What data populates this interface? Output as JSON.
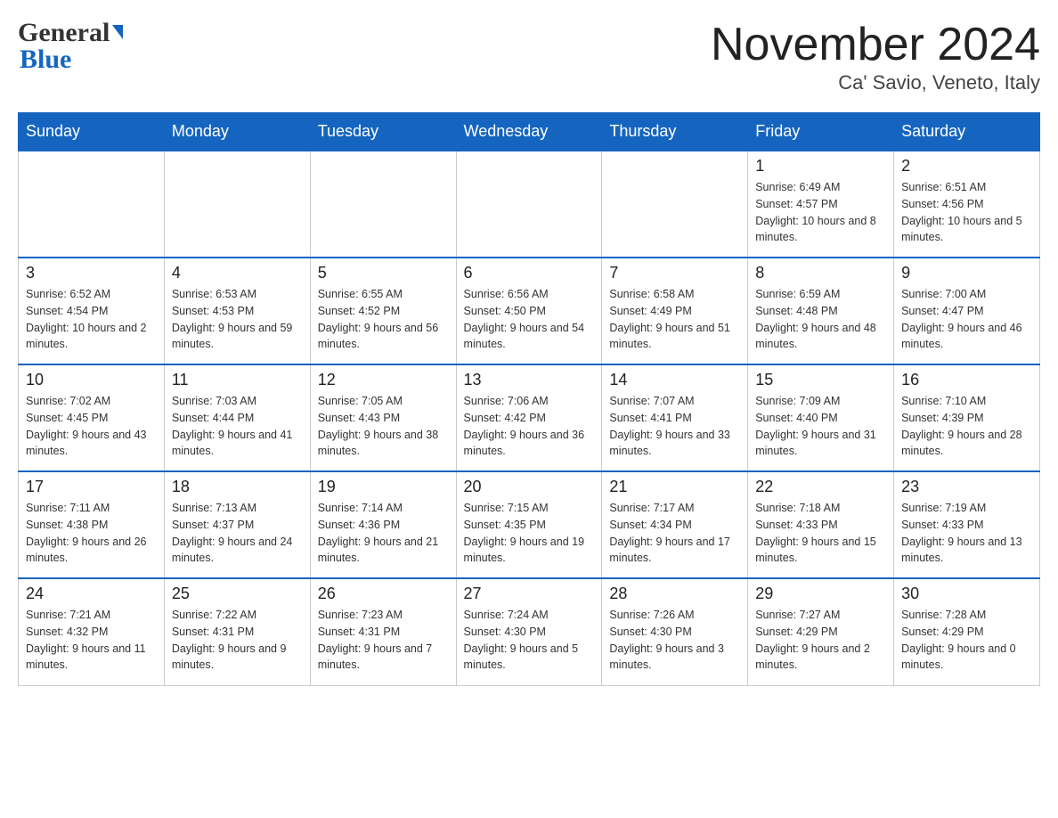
{
  "header": {
    "logo_general": "General",
    "logo_blue": "Blue",
    "month_title": "November 2024",
    "location": "Ca' Savio, Veneto, Italy"
  },
  "weekdays": [
    "Sunday",
    "Monday",
    "Tuesday",
    "Wednesday",
    "Thursday",
    "Friday",
    "Saturday"
  ],
  "weeks": [
    [
      {
        "day": "",
        "sunrise": "",
        "sunset": "",
        "daylight": ""
      },
      {
        "day": "",
        "sunrise": "",
        "sunset": "",
        "daylight": ""
      },
      {
        "day": "",
        "sunrise": "",
        "sunset": "",
        "daylight": ""
      },
      {
        "day": "",
        "sunrise": "",
        "sunset": "",
        "daylight": ""
      },
      {
        "day": "",
        "sunrise": "",
        "sunset": "",
        "daylight": ""
      },
      {
        "day": "1",
        "sunrise": "Sunrise: 6:49 AM",
        "sunset": "Sunset: 4:57 PM",
        "daylight": "Daylight: 10 hours and 8 minutes."
      },
      {
        "day": "2",
        "sunrise": "Sunrise: 6:51 AM",
        "sunset": "Sunset: 4:56 PM",
        "daylight": "Daylight: 10 hours and 5 minutes."
      }
    ],
    [
      {
        "day": "3",
        "sunrise": "Sunrise: 6:52 AM",
        "sunset": "Sunset: 4:54 PM",
        "daylight": "Daylight: 10 hours and 2 minutes."
      },
      {
        "day": "4",
        "sunrise": "Sunrise: 6:53 AM",
        "sunset": "Sunset: 4:53 PM",
        "daylight": "Daylight: 9 hours and 59 minutes."
      },
      {
        "day": "5",
        "sunrise": "Sunrise: 6:55 AM",
        "sunset": "Sunset: 4:52 PM",
        "daylight": "Daylight: 9 hours and 56 minutes."
      },
      {
        "day": "6",
        "sunrise": "Sunrise: 6:56 AM",
        "sunset": "Sunset: 4:50 PM",
        "daylight": "Daylight: 9 hours and 54 minutes."
      },
      {
        "day": "7",
        "sunrise": "Sunrise: 6:58 AM",
        "sunset": "Sunset: 4:49 PM",
        "daylight": "Daylight: 9 hours and 51 minutes."
      },
      {
        "day": "8",
        "sunrise": "Sunrise: 6:59 AM",
        "sunset": "Sunset: 4:48 PM",
        "daylight": "Daylight: 9 hours and 48 minutes."
      },
      {
        "day": "9",
        "sunrise": "Sunrise: 7:00 AM",
        "sunset": "Sunset: 4:47 PM",
        "daylight": "Daylight: 9 hours and 46 minutes."
      }
    ],
    [
      {
        "day": "10",
        "sunrise": "Sunrise: 7:02 AM",
        "sunset": "Sunset: 4:45 PM",
        "daylight": "Daylight: 9 hours and 43 minutes."
      },
      {
        "day": "11",
        "sunrise": "Sunrise: 7:03 AM",
        "sunset": "Sunset: 4:44 PM",
        "daylight": "Daylight: 9 hours and 41 minutes."
      },
      {
        "day": "12",
        "sunrise": "Sunrise: 7:05 AM",
        "sunset": "Sunset: 4:43 PM",
        "daylight": "Daylight: 9 hours and 38 minutes."
      },
      {
        "day": "13",
        "sunrise": "Sunrise: 7:06 AM",
        "sunset": "Sunset: 4:42 PM",
        "daylight": "Daylight: 9 hours and 36 minutes."
      },
      {
        "day": "14",
        "sunrise": "Sunrise: 7:07 AM",
        "sunset": "Sunset: 4:41 PM",
        "daylight": "Daylight: 9 hours and 33 minutes."
      },
      {
        "day": "15",
        "sunrise": "Sunrise: 7:09 AM",
        "sunset": "Sunset: 4:40 PM",
        "daylight": "Daylight: 9 hours and 31 minutes."
      },
      {
        "day": "16",
        "sunrise": "Sunrise: 7:10 AM",
        "sunset": "Sunset: 4:39 PM",
        "daylight": "Daylight: 9 hours and 28 minutes."
      }
    ],
    [
      {
        "day": "17",
        "sunrise": "Sunrise: 7:11 AM",
        "sunset": "Sunset: 4:38 PM",
        "daylight": "Daylight: 9 hours and 26 minutes."
      },
      {
        "day": "18",
        "sunrise": "Sunrise: 7:13 AM",
        "sunset": "Sunset: 4:37 PM",
        "daylight": "Daylight: 9 hours and 24 minutes."
      },
      {
        "day": "19",
        "sunrise": "Sunrise: 7:14 AM",
        "sunset": "Sunset: 4:36 PM",
        "daylight": "Daylight: 9 hours and 21 minutes."
      },
      {
        "day": "20",
        "sunrise": "Sunrise: 7:15 AM",
        "sunset": "Sunset: 4:35 PM",
        "daylight": "Daylight: 9 hours and 19 minutes."
      },
      {
        "day": "21",
        "sunrise": "Sunrise: 7:17 AM",
        "sunset": "Sunset: 4:34 PM",
        "daylight": "Daylight: 9 hours and 17 minutes."
      },
      {
        "day": "22",
        "sunrise": "Sunrise: 7:18 AM",
        "sunset": "Sunset: 4:33 PM",
        "daylight": "Daylight: 9 hours and 15 minutes."
      },
      {
        "day": "23",
        "sunrise": "Sunrise: 7:19 AM",
        "sunset": "Sunset: 4:33 PM",
        "daylight": "Daylight: 9 hours and 13 minutes."
      }
    ],
    [
      {
        "day": "24",
        "sunrise": "Sunrise: 7:21 AM",
        "sunset": "Sunset: 4:32 PM",
        "daylight": "Daylight: 9 hours and 11 minutes."
      },
      {
        "day": "25",
        "sunrise": "Sunrise: 7:22 AM",
        "sunset": "Sunset: 4:31 PM",
        "daylight": "Daylight: 9 hours and 9 minutes."
      },
      {
        "day": "26",
        "sunrise": "Sunrise: 7:23 AM",
        "sunset": "Sunset: 4:31 PM",
        "daylight": "Daylight: 9 hours and 7 minutes."
      },
      {
        "day": "27",
        "sunrise": "Sunrise: 7:24 AM",
        "sunset": "Sunset: 4:30 PM",
        "daylight": "Daylight: 9 hours and 5 minutes."
      },
      {
        "day": "28",
        "sunrise": "Sunrise: 7:26 AM",
        "sunset": "Sunset: 4:30 PM",
        "daylight": "Daylight: 9 hours and 3 minutes."
      },
      {
        "day": "29",
        "sunrise": "Sunrise: 7:27 AM",
        "sunset": "Sunset: 4:29 PM",
        "daylight": "Daylight: 9 hours and 2 minutes."
      },
      {
        "day": "30",
        "sunrise": "Sunrise: 7:28 AM",
        "sunset": "Sunset: 4:29 PM",
        "daylight": "Daylight: 9 hours and 0 minutes."
      }
    ]
  ]
}
